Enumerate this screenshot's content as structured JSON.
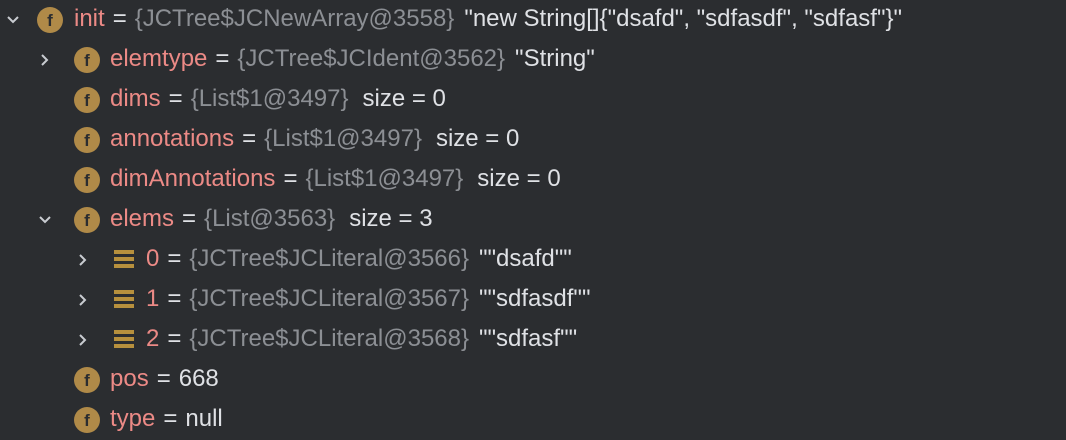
{
  "variables": {
    "init": {
      "name": "init",
      "eq": "=",
      "ref": "{JCTree$JCNewArray@3558}",
      "value": "\"new String[]{\"dsafd\", \"sdfasdf\", \"sdfasf\"}\"",
      "expanded": true
    },
    "elemtype": {
      "name": "elemtype",
      "eq": "=",
      "ref": "{JCTree$JCIdent@3562}",
      "value": "\"String\"",
      "expanded": false
    },
    "dims": {
      "name": "dims",
      "eq": "=",
      "ref": "{List$1@3497}",
      "value": "size = 0"
    },
    "annotations": {
      "name": "annotations",
      "eq": "=",
      "ref": "{List$1@3497}",
      "value": "size = 0"
    },
    "dimAnnotations": {
      "name": "dimAnnotations",
      "eq": "=",
      "ref": "{List$1@3497}",
      "value": "size = 0"
    },
    "elems": {
      "name": "elems",
      "eq": "=",
      "ref": "{List@3563}",
      "value": "size = 3",
      "expanded": true,
      "items": [
        {
          "index": "0",
          "eq": "=",
          "ref": "{JCTree$JCLiteral@3566}",
          "value": "\"\"dsafd\"\""
        },
        {
          "index": "1",
          "eq": "=",
          "ref": "{JCTree$JCLiteral@3567}",
          "value": "\"\"sdfasdf\"\""
        },
        {
          "index": "2",
          "eq": "=",
          "ref": "{JCTree$JCLiteral@3568}",
          "value": "\"\"sdfasf\"\""
        }
      ]
    },
    "pos": {
      "name": "pos",
      "eq": "=",
      "value": "668"
    },
    "type": {
      "name": "type",
      "eq": "=",
      "value": "null"
    }
  },
  "icons": {
    "field_badge_letter": "f",
    "field_badge_color": "#b08a48",
    "array_icon_color": "#b7903d",
    "expanded_arrow": "chevron-down-icon",
    "collapsed_arrow": "chevron-right-icon"
  },
  "colors": {
    "background": "#2b2d30",
    "name": "#ec8a86",
    "ref": "#8c8f94",
    "value": "#dfe1e5"
  }
}
